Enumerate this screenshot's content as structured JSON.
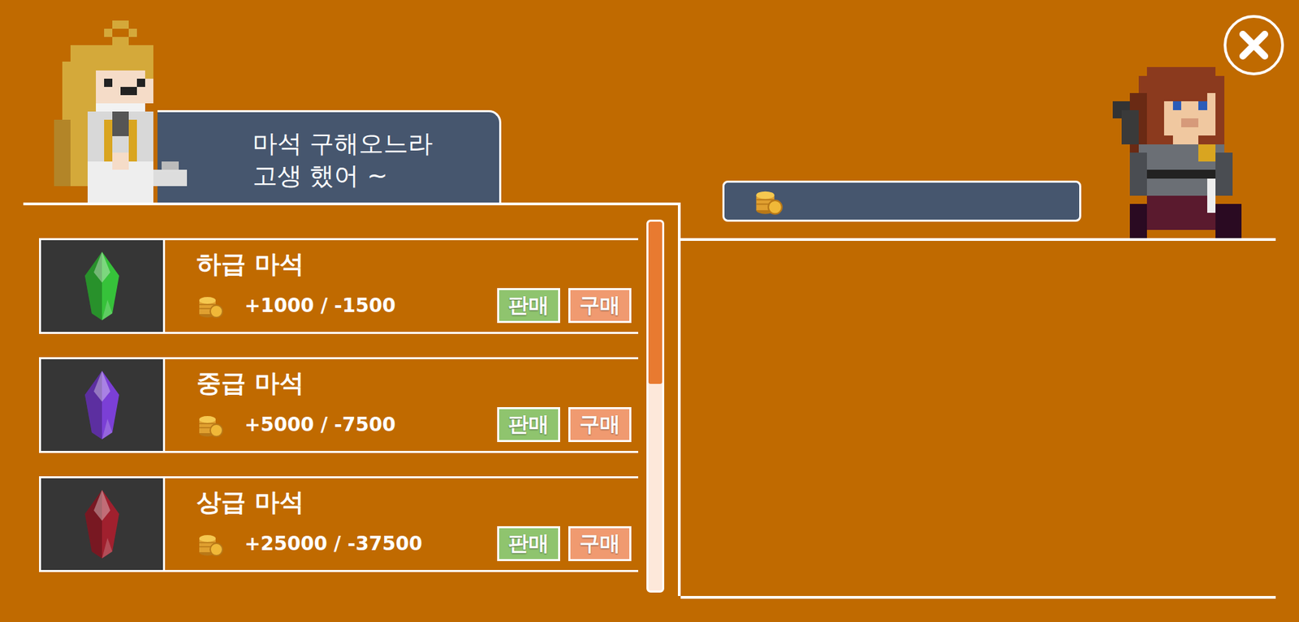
{
  "dialog": {
    "lines": [
      "마석 구해오느라",
      "고생 했어 ~"
    ]
  },
  "items": [
    {
      "name": "하급 마석",
      "price": "+1000 / -1500",
      "color": "#36c23a",
      "sell": "판매",
      "buy": "구매"
    },
    {
      "name": "중급 마석",
      "price": "+5000 / -7500",
      "color": "#7b3fd6",
      "sell": "판매",
      "buy": "구매"
    },
    {
      "name": "상급 마석",
      "price": "+25000 / -37500",
      "color": "#a0202e",
      "sell": "판매",
      "buy": "구매"
    }
  ],
  "scrollbar": {
    "level": 0.44
  }
}
